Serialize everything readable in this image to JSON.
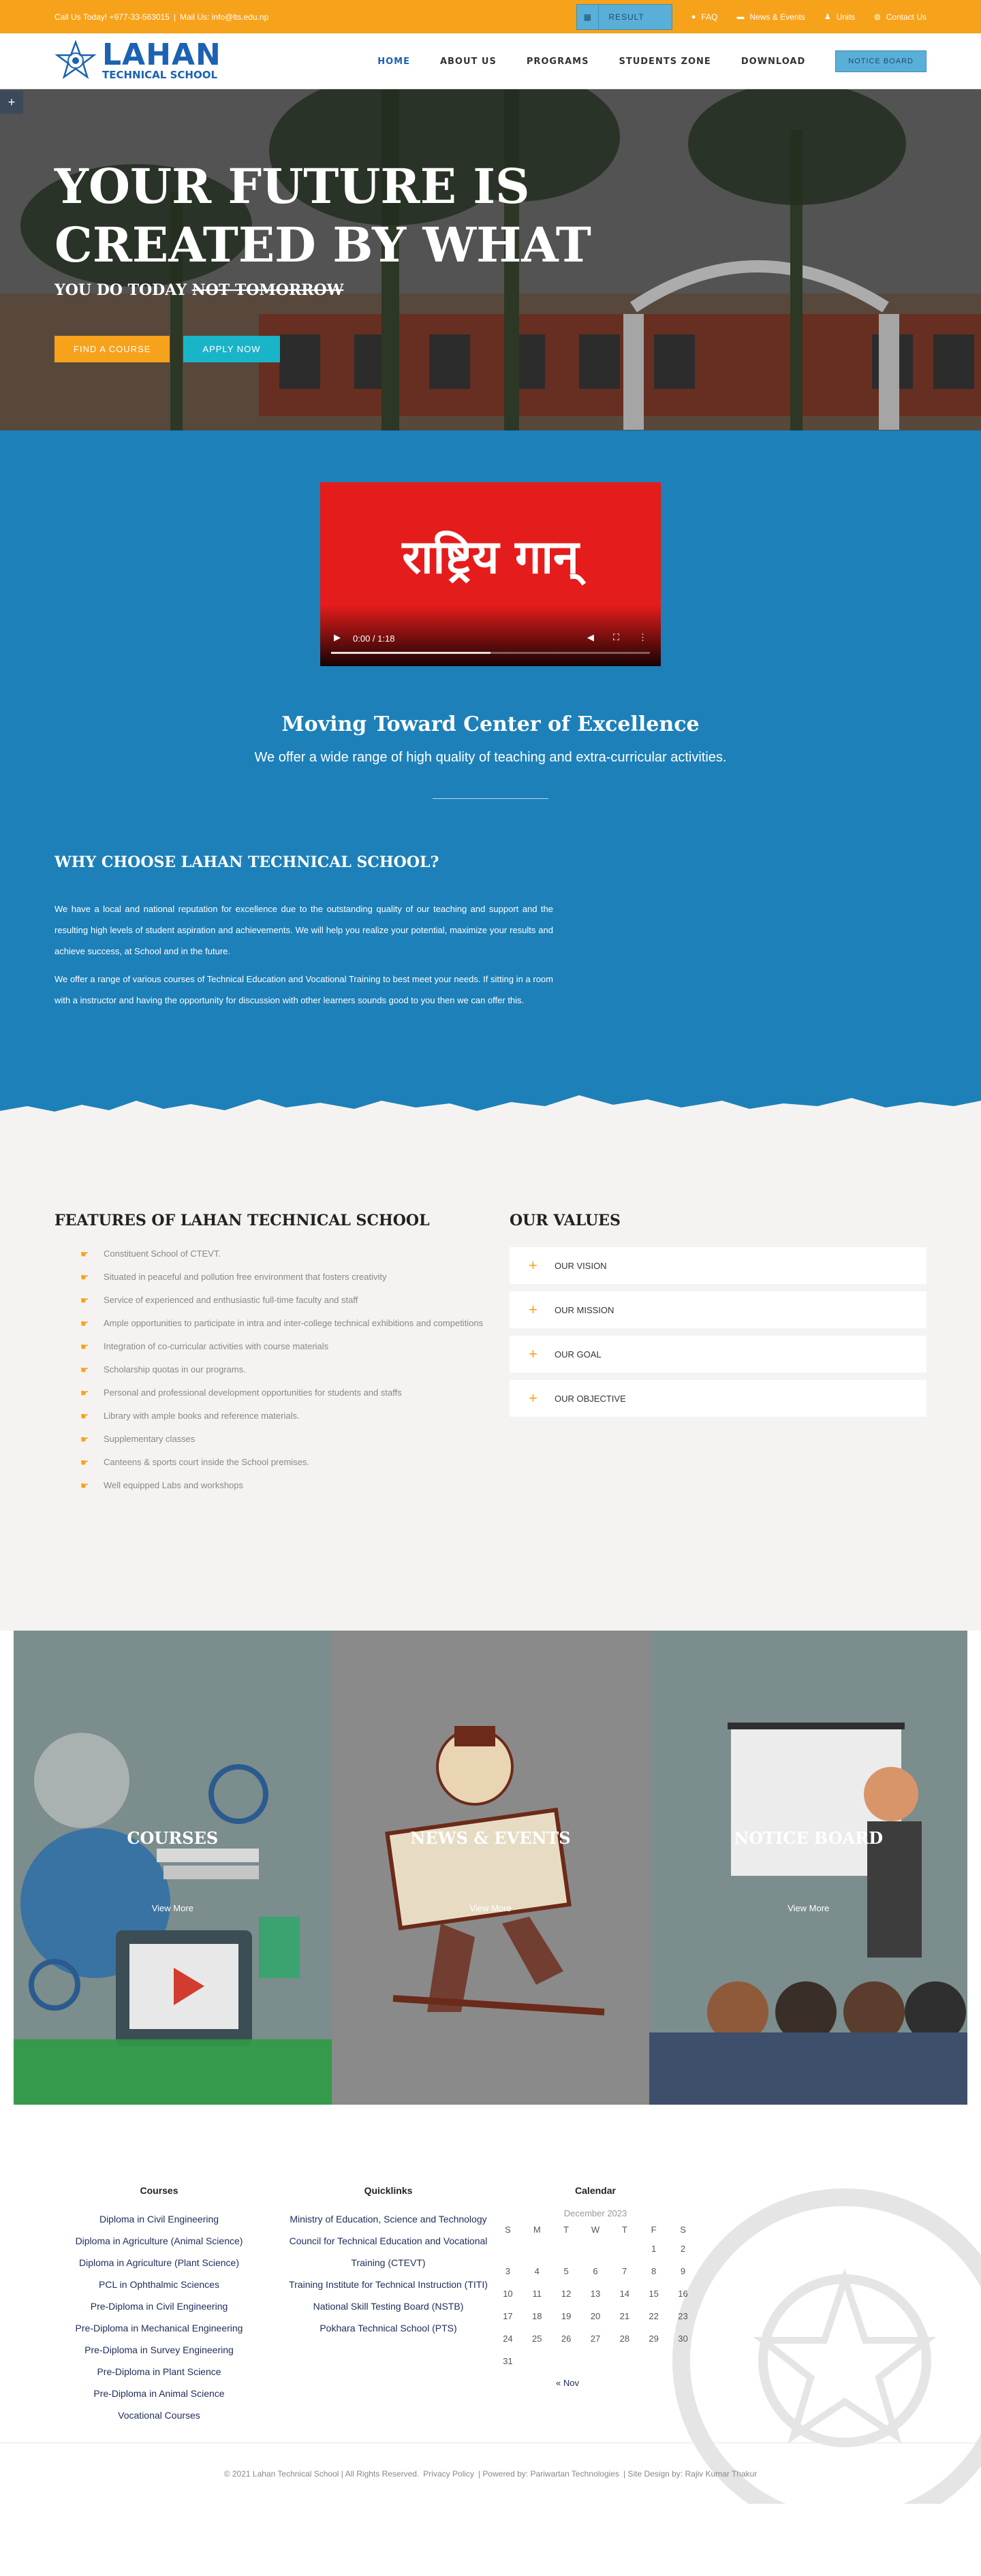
{
  "topbar": {
    "phone_text": "Call Us Today! +977-33-563015",
    "separator": "|",
    "mail_text": "Mail Us: info@lts.edu.np",
    "result_label": "RESULT",
    "links": [
      {
        "icon": "question-icon",
        "label": "FAQ"
      },
      {
        "icon": "newspaper-icon",
        "label": "News & Events"
      },
      {
        "icon": "users-icon",
        "label": "Units"
      },
      {
        "icon": "globe-icon",
        "label": "Contact Us"
      }
    ]
  },
  "header": {
    "logo_line1": "LAHAN",
    "logo_line2": "TECHNICAL SCHOOL",
    "nav": [
      "HOME",
      "ABOUT US",
      "PROGRAMS",
      "STUDENTS ZONE",
      "DOWNLOAD"
    ],
    "notice_board_label": "NOTICE BOARD"
  },
  "hero": {
    "title_line1": "YOUR FUTURE IS",
    "title_line2": "CREATED BY WHAT",
    "subtitle_main": "YOU DO TODAY",
    "subtitle_struck": "NOT TOMORROW",
    "btn_course": "FIND A COURSE",
    "btn_apply": "APPLY NOW",
    "plus": "+"
  },
  "video": {
    "title": "राष्ट्रिय गान्",
    "time": "0:00 / 1:18",
    "progress": 0.5
  },
  "intro": {
    "title": "Moving Toward Center of Excellence",
    "subtitle": "We offer a wide range of high quality of teaching and extra-curricular activities."
  },
  "why": {
    "title": "WHY CHOOSE LAHAN TECHNICAL SCHOOL?",
    "p1": "We have a local and national reputation for excellence due to the outstanding quality of our teaching and support and the resulting high levels of student aspiration and achievements. We will help you realize your potential, maximize your results and achieve success, at School and in the future.",
    "p2": "We offer a range of various courses of Technical Education and Vocational Training to best meet your needs. If sitting in a room with a instructor and having the opportunity for discussion with other learners sounds good to you then we can offer this."
  },
  "features": {
    "title": "FEATURES OF LAHAN TECHNICAL SCHOOL",
    "items": [
      "Constituent School of CTEVT.",
      "Situated in peaceful and pollution free environment that fosters creativity",
      "Service of experienced and enthusiastic full-time faculty and staff",
      "Ample opportunities to participate in intra and inter-college technical exhibitions and competitions",
      "Integration of co-curricular activities with course materials",
      "Scholarship quotas in our programs.",
      "Personal and professional development opportunities for students and staffs",
      "Library with ample books and reference materials.",
      "Supplementary classes",
      "Canteens & sports court inside the School premises.",
      "Well equipped Labs and workshops"
    ]
  },
  "values": {
    "title": "OUR VALUES",
    "items": [
      "OUR VISION",
      "OUR MISSION",
      "OUR GOAL",
      "OUR OBJECTIVE"
    ]
  },
  "tiles": [
    {
      "title": "COURSES",
      "link": "View More"
    },
    {
      "title": "NEWS & EVENTS",
      "link": "View More"
    },
    {
      "title": "NOTICE BOARD",
      "link": "View More"
    }
  ],
  "footer": {
    "courses_title": "Courses",
    "courses": [
      "Diploma in Civil Engineering",
      "Diploma in Agriculture (Animal Science)",
      "Diploma in Agriculture (Plant Science)",
      "PCL in Ophthalmic Sciences",
      "Pre-Diploma in Civil Engineering",
      "Pre-Diploma in Mechanical Engineering",
      "Pre-Diploma in Survey Engineering",
      "Pre-Diploma in Plant Science",
      "Pre-Diploma in Animal Science",
      "Vocational Courses"
    ],
    "quicklinks_title": "Quicklinks",
    "quicklinks": [
      "Ministry of Education, Science and Technology",
      "Council for Technical Education and Vocational Training (CTEVT)",
      "Training Institute for Technical Instruction (TITI)",
      "National Skill Testing Board (NSTB)",
      "Pokhara Technical School (PTS)"
    ],
    "calendar_title": "Calendar",
    "calendar_caption": "December 2023",
    "weekdays": [
      "S",
      "M",
      "T",
      "W",
      "T",
      "F",
      "S"
    ],
    "weeks": [
      [
        "",
        "",
        "",
        "",
        "",
        "1",
        "2"
      ],
      [
        "3",
        "4",
        "5",
        "6",
        "7",
        "8",
        "9"
      ],
      [
        "10",
        "11",
        "12",
        "13",
        "14",
        "15",
        "16"
      ],
      [
        "17",
        "18",
        "19",
        "20",
        "21",
        "22",
        "23"
      ],
      [
        "24",
        "25",
        "26",
        "27",
        "28",
        "29",
        "30"
      ],
      [
        "31",
        "",
        "",
        "",
        "",
        "",
        ""
      ]
    ],
    "prev_label": "« Nov",
    "copyright": "© 2021 Lahan Technical School | All Rights Reserved.",
    "privacy": "Privacy Policy",
    "powered": "| Powered by: Pariwartan Technologies",
    "design": "| Site Design by: Rajiv Kumar Thakur"
  },
  "colors": {
    "orange": "#f7a21b",
    "blue": "#1d80b9",
    "brand_blue": "#1b62b3",
    "cyan": "#1ab4c8"
  }
}
